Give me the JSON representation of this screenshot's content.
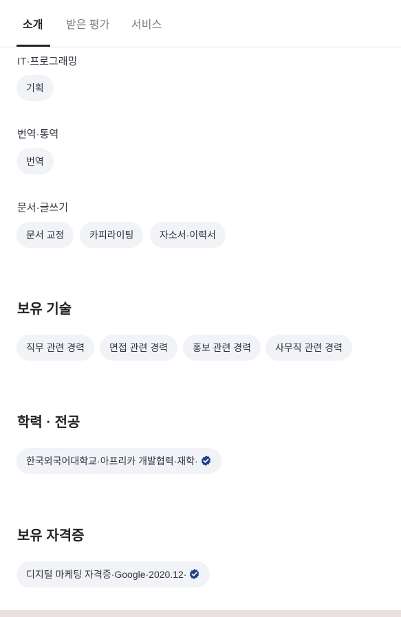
{
  "tabs": [
    {
      "label": "소개",
      "active": true
    },
    {
      "label": "받은 평가",
      "active": false
    },
    {
      "label": "서비스",
      "active": false
    }
  ],
  "categories": [
    {
      "title": "IT·프로그래밍",
      "tags": [
        "기획"
      ]
    },
    {
      "title": "번역·통역",
      "tags": [
        "번역"
      ]
    },
    {
      "title": "문서·글쓰기",
      "tags": [
        "문서 교정",
        "카피라이팅",
        "자소서·이력서"
      ]
    }
  ],
  "skills": {
    "title": "보유 기술",
    "tags": [
      "직무 관련 경력",
      "면접 관련 경력",
      "홍보 관련 경력",
      "사무직 관련 경력"
    ]
  },
  "education": {
    "title": "학력 · 전공",
    "items": [
      {
        "text": "한국외국어대학교·아프리카 개발협력·재학·",
        "verified": true
      }
    ]
  },
  "certificates": {
    "title": "보유 자격증",
    "items": [
      {
        "text": "디지털 마케팅 자격증·Google·2020.12·",
        "verified": true
      }
    ]
  },
  "colors": {
    "verified_badge": "#1f3f8f",
    "chip_bg": "#f2f3f7"
  }
}
